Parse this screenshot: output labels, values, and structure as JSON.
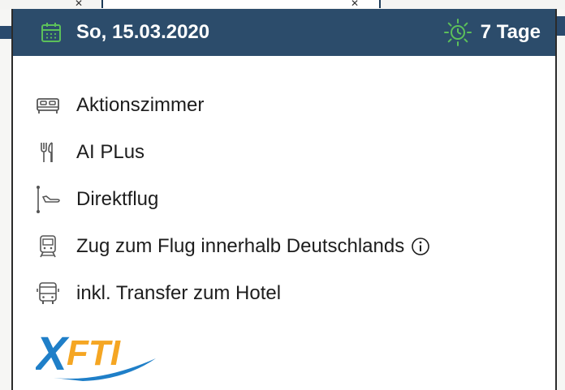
{
  "header": {
    "date": "So, 15.03.2020",
    "duration": "7 Tage",
    "accent_color": "#5cc05a",
    "background_color": "#2c4c6b"
  },
  "features": [
    {
      "icon": "bed-icon",
      "label": "Aktionszimmer"
    },
    {
      "icon": "cutlery-icon",
      "label": "AI PLus"
    },
    {
      "icon": "flight-icon",
      "label": "Direktflug"
    },
    {
      "icon": "train-icon",
      "label": "Zug zum Flug innerhalb Deutschlands",
      "info": true
    },
    {
      "icon": "bus-icon",
      "label": "inkl. Transfer zum Hotel"
    }
  ],
  "logo": {
    "text": "XFTI",
    "colors": {
      "x": "#1f7fc8",
      "fti": "#f5a623",
      "swoosh": "#1f7fc8"
    }
  }
}
